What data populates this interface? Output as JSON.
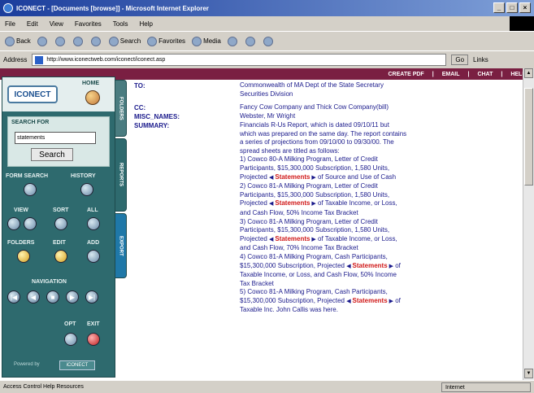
{
  "window": {
    "title": "ICONECT - [Documents [browse]] - Microsoft Internet Explorer",
    "controls": [
      "_",
      "□",
      "×"
    ]
  },
  "menu": [
    "File",
    "Edit",
    "View",
    "Favorites",
    "Tools",
    "Help"
  ],
  "toolbar": {
    "back": "Back",
    "search": "Search",
    "favorites": "Favorites",
    "media": "Media"
  },
  "address": {
    "label": "Address",
    "url": "http://www.iconectweb.com/iconect/iconect.asp",
    "go": "Go",
    "links": "Links"
  },
  "topnav": [
    "CREATE PDF",
    "|",
    "EMAIL",
    "|",
    "CHAT",
    "|",
    "HELP"
  ],
  "sidebar": {
    "logo": "ICONECT",
    "home_label": "HOME",
    "search_label": "SEARCH FOR",
    "search_value": "statements",
    "search_button": "Search",
    "form_search": "FORM SEARCH",
    "history": "HISTORY",
    "view": "VIEW",
    "sort": "SORT",
    "all": "ALL",
    "folders": "FOLDERS",
    "edit": "EDIT",
    "add": "ADD",
    "navigation": "NAVIGATION",
    "nav_buttons": [
      "|◀",
      "◀",
      "■",
      "▶",
      "▶|"
    ],
    "opt": "OPT",
    "exit": "EXIT",
    "footer_label": "Powered by",
    "footer_button": "iCONECT"
  },
  "tabs": [
    "FOLDERS",
    "REPORTS",
    "EXPORT"
  ],
  "document": {
    "fields": [
      {
        "label": "TO:",
        "lines": [
          "Commonwealth of MA Dept of the State Secretary",
          "Securities Division"
        ]
      },
      {
        "label": "CC:",
        "lines": [
          "Fancy Cow Company and Thick Cow Company(bill)"
        ]
      },
      {
        "label": "MISC_NAMES:",
        "lines": [
          "Webster, Mr Wright"
        ]
      },
      {
        "label": "SUMMARY:",
        "lines": [
          "Financials R-Us Report, which is dated 09/10/11 but",
          "which was prepared on the same day. The report contains",
          "a series of projections from 09/10/00 to 09/30/00. The",
          "spread sheets are titled as follows:",
          "1) Cowco 80-A Milking Program, Letter of Credit",
          "Participants, $15,300,000 Subscription, 1,580 Units,",
          "Projected |Statements| of Source and Use of Cash",
          "2) Cowco 81-A Milking Program, Letter of Credit",
          "Participants, $15,300,000 Subscription, 1,580 Units,",
          "Projected |Statements| of Taxable Income, or Loss,",
          "and Cash Flow, 50% Income Tax Bracket",
          "3) Cowco 81-A Milking Program, Letter of Credit",
          "Participants, $15,300,000 Subscription, 1,580 Units,",
          "Projected |Statements| of Taxable Income, or Loss,",
          "and Cash Flow, 70% Income Tax Bracket",
          "4) Cowco 81-A Milking Program, Cash Participants,",
          "$15,300,000 Subscription, Projected |Statements| of",
          "Taxable Income, or Loss, and Cash Flow, 50% Income",
          "Tax Bracket",
          "5) Cowco 81-A Milking Program, Cash Participants,",
          "$15,300,000 Subscription, Projected |Statements| of",
          "Taxable Inc. John Callis was here."
        ]
      }
    ]
  },
  "status": {
    "text": "Access Control Help Resources",
    "zone": "Internet"
  }
}
